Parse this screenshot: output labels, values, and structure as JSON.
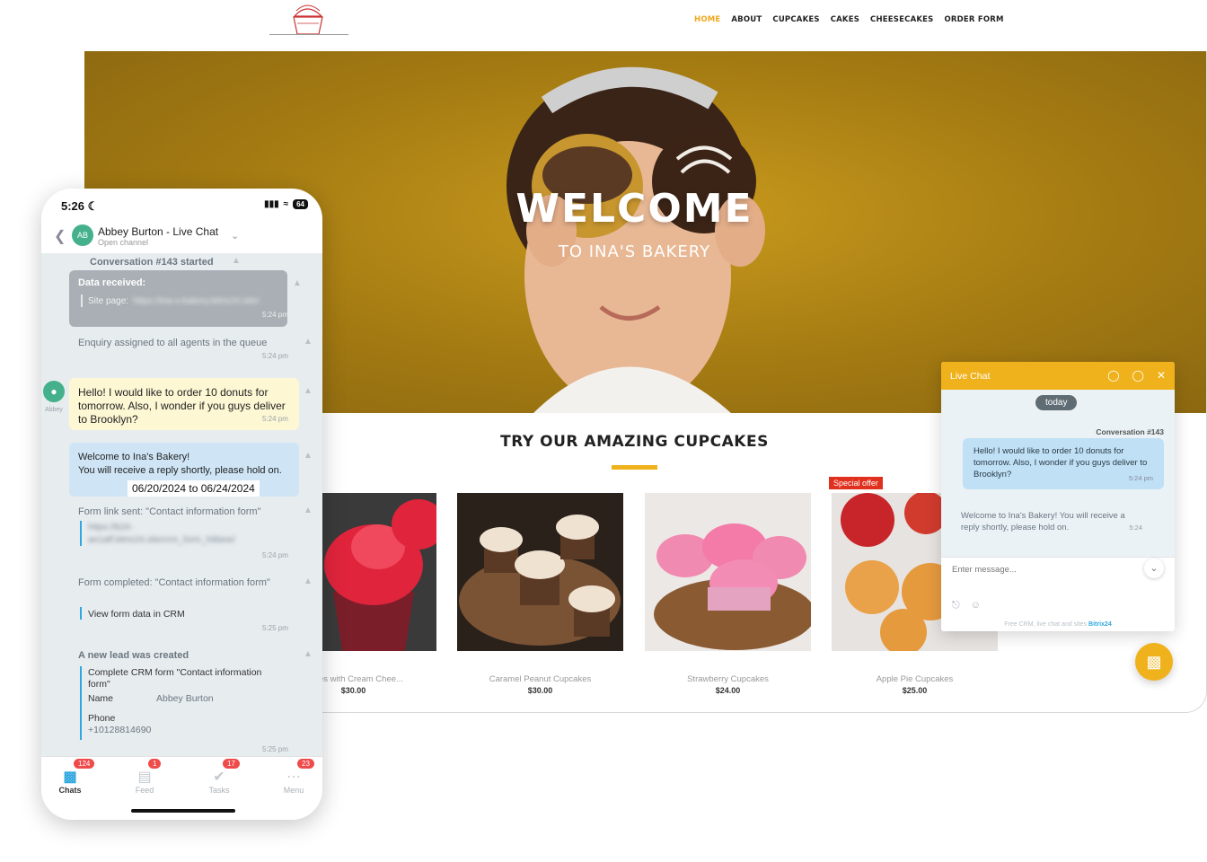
{
  "site": {
    "nav": [
      "HOME",
      "ABOUT",
      "CUPCAKES",
      "CAKES",
      "CHEESECAKES",
      "ORDER FORM"
    ],
    "logo_text": "INA'S BAKERY",
    "hero_title": "WELCOME",
    "hero_subtitle": "TO INA'S BAKERY",
    "section_title": "TRY OUR AMAZING CUPCAKES",
    "special_offer": "Special offer",
    "products": [
      {
        "name": "Cakes with Cream Chee...",
        "price": "$30.00"
      },
      {
        "name": "Caramel Peanut Cupcakes",
        "price": "$30.00"
      },
      {
        "name": "Strawberry Cupcakes",
        "price": "$24.00"
      },
      {
        "name": "Apple Pie Cupcakes",
        "price": "$25.00"
      }
    ],
    "colors": {
      "accent": "#f0b21c",
      "badge": "#e0301e"
    }
  },
  "live_chat": {
    "title": "Live Chat",
    "today": "today",
    "conversation": "Conversation #143",
    "client_message": "Hello! I would like to order 10 donuts for tomorrow. Also, I wonder if you guys deliver to Brooklyn?",
    "client_time": "5:24 pm",
    "welcome_message": "Welcome to Ina's Bakery! You will receive a reply shortly, please hold on.",
    "welcome_time": "5:24",
    "input_placeholder": "Enter message...",
    "footer": "Free CRM, live chat and sites",
    "footer_brand": "Bitrix24"
  },
  "phone": {
    "time": "5:26",
    "battery": "64",
    "avatar_initials": "AB",
    "contact_name": "Abbey Burton - Live Chat",
    "channel": "Open channel",
    "conversation_started": "Conversation #143 started",
    "data_received": "Data received:",
    "site_page_label": "Site page:",
    "site_page_url": "https://ina-s-bakery.bitrix24.site/",
    "data_time": "5:24 pm",
    "enquiry": "Enquiry assigned to all agents in the queue",
    "enquiry_time": "5:24 pm",
    "sender": "Abbey",
    "client_message": "Hello! I would like to order 10 donuts for tomorrow. Also, I wonder if you guys deliver to Brooklyn?",
    "client_link_word": "tomorrow",
    "client_time": "5:24 pm",
    "welcome_line1": "Welcome to Ina's Bakery!",
    "welcome_line2": "You will receive a reply shortly, please hold on.",
    "date_range": "06/20/2024 to 06/24/2024",
    "welcome_time": "5:24 pm",
    "form_link_sent": "Form link sent: \"Contact information form\"",
    "form_link_url1": "https://b24-",
    "form_link_url2": "ae1aff.bitrix24.site/crm_form_h6bew/",
    "form_link_time": "5:24 pm",
    "form_completed": "Form completed: \"Contact information form\"",
    "view_form": "View form data in CRM",
    "form_completed_time": "5:25 pm",
    "lead_created": "A new lead was created",
    "crm_form": "Complete CRM form \"Contact information form\"",
    "name_label": "Name",
    "name_value": "Abbey Burton",
    "phone_label": "Phone",
    "phone_value": "+10128814690",
    "lead_time": "5:25 pm",
    "tabs": [
      {
        "label": "Chats",
        "count": "124"
      },
      {
        "label": "Feed",
        "count": "1"
      },
      {
        "label": "Tasks",
        "count": "17"
      },
      {
        "label": "Menu",
        "count": "23"
      }
    ]
  }
}
